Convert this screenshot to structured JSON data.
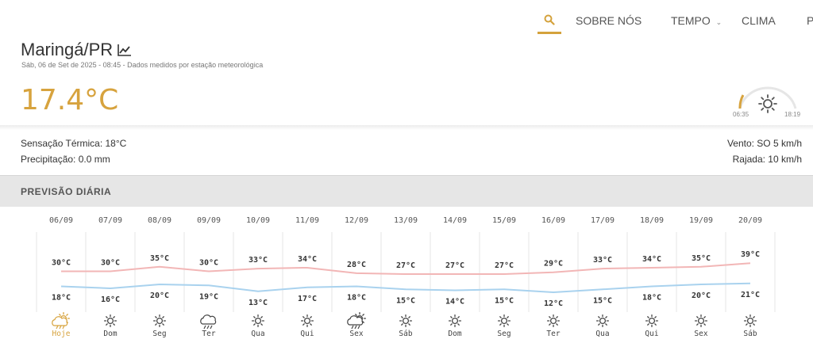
{
  "nav": {
    "items": [
      "SOBRE NÓS",
      "TEMPO",
      "CLIMA",
      "P"
    ]
  },
  "location": {
    "city": "Maringá/PR",
    "subtitle": "Sáb, 06 de Set de 2025 - 08:45 - Dados medidos por estação meteorológica"
  },
  "current": {
    "temperature": "17.4°C",
    "sunrise": "06:35",
    "sunset": "18:19",
    "sensation": "Sensação Térmica: 18°C",
    "precipitation": "Precipitação: 0.0 mm",
    "wind": "Vento: SO 5 km/h",
    "gust": "Rajada: 10 km/h"
  },
  "forecast_title": "PREVISÃO DIÁRIA",
  "colors": {
    "accent": "#d7a33e",
    "max_line": "#f2b6b6",
    "min_line": "#a9d2ee"
  },
  "chart_data": {
    "type": "line",
    "x": [
      "06/09",
      "07/09",
      "08/09",
      "09/09",
      "10/09",
      "11/09",
      "12/09",
      "13/09",
      "14/09",
      "15/09",
      "16/09",
      "17/09",
      "18/09",
      "19/09",
      "20/09"
    ],
    "weekdays": [
      "Hoje",
      "Dom",
      "Seg",
      "Ter",
      "Qua",
      "Qui",
      "Sex",
      "Sáb",
      "Dom",
      "Seg",
      "Ter",
      "Qua",
      "Qui",
      "Sex",
      "Sáb"
    ],
    "icons": [
      "partly-cloudy-icon",
      "sun-icon",
      "sun-icon",
      "storm-icon",
      "sun-icon",
      "sun-icon",
      "rain-icon",
      "sun-icon",
      "sun-icon",
      "sun-icon",
      "sun-icon",
      "sun-icon",
      "sun-icon",
      "sun-icon",
      "sun-icon"
    ],
    "series": [
      {
        "values": [
          30,
          30,
          35,
          30,
          33,
          34,
          28,
          27,
          27,
          27,
          29,
          33,
          34,
          35,
          39
        ]
      },
      {
        "values": [
          18,
          16,
          20,
          19,
          13,
          17,
          18,
          15,
          14,
          15,
          12,
          15,
          18,
          20,
          21
        ]
      }
    ],
    "unit": "°C"
  }
}
